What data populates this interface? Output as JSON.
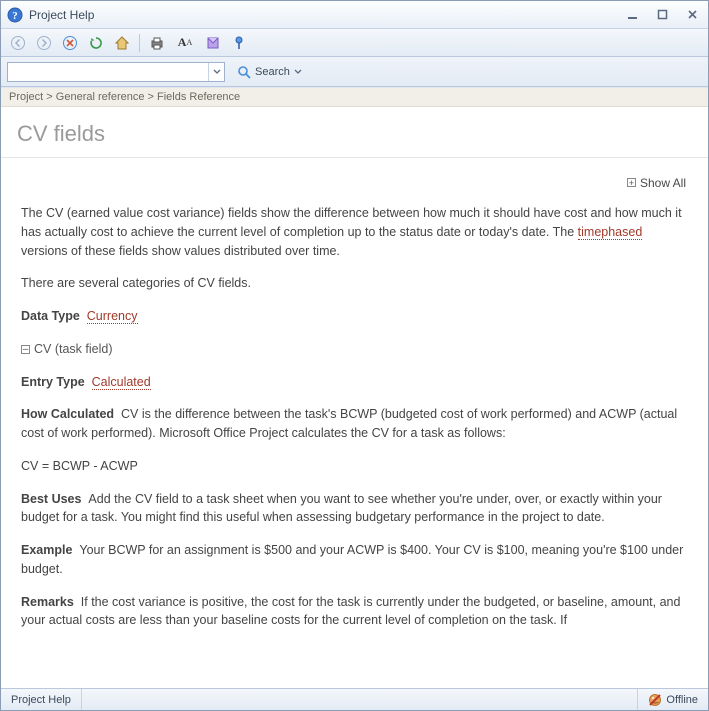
{
  "window": {
    "title": "Project Help"
  },
  "toolbar": {
    "search_label": "Search"
  },
  "breadcrumb": {
    "items": [
      "Project",
      "General reference",
      "Fields Reference"
    ],
    "sep": " > "
  },
  "page": {
    "title": "CV fields",
    "show_all": "Show All"
  },
  "content": {
    "intro_pre": "The CV (earned value cost variance) fields show the difference between how much it should have cost and how much it has actually cost to achieve the current level of completion up to the status date or today's date. The ",
    "intro_link": "timephased",
    "intro_post": " versions of these fields show values distributed over time.",
    "categories": "There are several categories of CV fields.",
    "data_type_label": "Data Type",
    "data_type_value": "Currency",
    "section_label": "CV (task field)",
    "entry_type_label": "Entry Type",
    "entry_type_value": "Calculated",
    "how_calc_label": "How Calculated",
    "how_calc_body": "CV is the difference between the task's BCWP (budgeted cost of work performed) and ACWP (actual cost of work performed). Microsoft Office Project calculates the CV for a task as follows:",
    "formula": "CV = BCWP - ACWP",
    "best_uses_label": "Best Uses",
    "best_uses_body": "Add the CV field to a task sheet when you want to see whether you're under, over, or exactly within your budget for a task. You might find this useful when assessing budgetary performance in the project to date.",
    "example_label": "Example",
    "example_body": "Your BCWP for an assignment is $500 and your ACWP is $400. Your CV is $100, meaning you're $100 under budget.",
    "remarks_label": "Remarks",
    "remarks_body": "If the cost variance is positive, the cost for the task is currently under the budgeted, or baseline, amount, and your actual costs are less than your baseline costs for the current level of completion on the task. If"
  },
  "status": {
    "left": "Project Help",
    "right": "Offline"
  }
}
